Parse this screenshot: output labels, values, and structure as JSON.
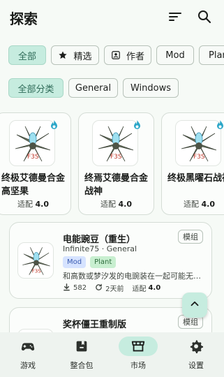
{
  "header": {
    "title": "探索",
    "icons": [
      "sort-icon",
      "search-icon"
    ]
  },
  "filters_row1": [
    {
      "label": "全部",
      "selected": true,
      "icon": ""
    },
    {
      "label": "精选",
      "selected": false,
      "icon": "star-icon"
    },
    {
      "label": "作者",
      "selected": false,
      "icon": "person-icon"
    },
    {
      "label": "Mod",
      "selected": false,
      "icon": ""
    },
    {
      "label": "Plant",
      "selected": false,
      "icon": ""
    }
  ],
  "filters_row2": [
    {
      "label": "全部分类",
      "selected": true
    },
    {
      "label": "General",
      "selected": false
    },
    {
      "label": "Windows",
      "selected": false
    }
  ],
  "featured": [
    {
      "name": "终极艾德曼合金高坚果",
      "ver_label": "适配",
      "ver": "4.0"
    },
    {
      "name": "终焉艾德曼合金战神",
      "ver_label": "适配",
      "ver": "4.0"
    },
    {
      "name": "终极黑曜石战神",
      "ver_label": "适配",
      "ver": "4.0"
    }
  ],
  "list": [
    {
      "name": "电能豌豆（重生）",
      "type": "模组",
      "author": "Infinite75 · General",
      "badges": [
        "Mod",
        "Plant"
      ],
      "desc": "和高数或梦汐发的电豌装在一起可能无…",
      "downloads": "582",
      "updated": "2天前",
      "ver_label": "适配",
      "ver": "4.0"
    },
    {
      "name": "奖杯僵王重制版",
      "type": "模组"
    }
  ],
  "nav": [
    {
      "label": "游戏",
      "icon": "gamepad-icon",
      "active": false
    },
    {
      "label": "整合包",
      "icon": "package-icon",
      "active": false
    },
    {
      "label": "市场",
      "icon": "store-icon",
      "active": true
    },
    {
      "label": "设置",
      "icon": "gear-icon",
      "active": false
    }
  ],
  "colors": {
    "accent_container": "#c6ecdf",
    "accent_text": "#2f6b58",
    "background": "#f6faf6",
    "badge_mod_bg": "#d6e3ff",
    "badge_plant_bg": "#c8efd0",
    "flame": "#2aa6c8"
  }
}
